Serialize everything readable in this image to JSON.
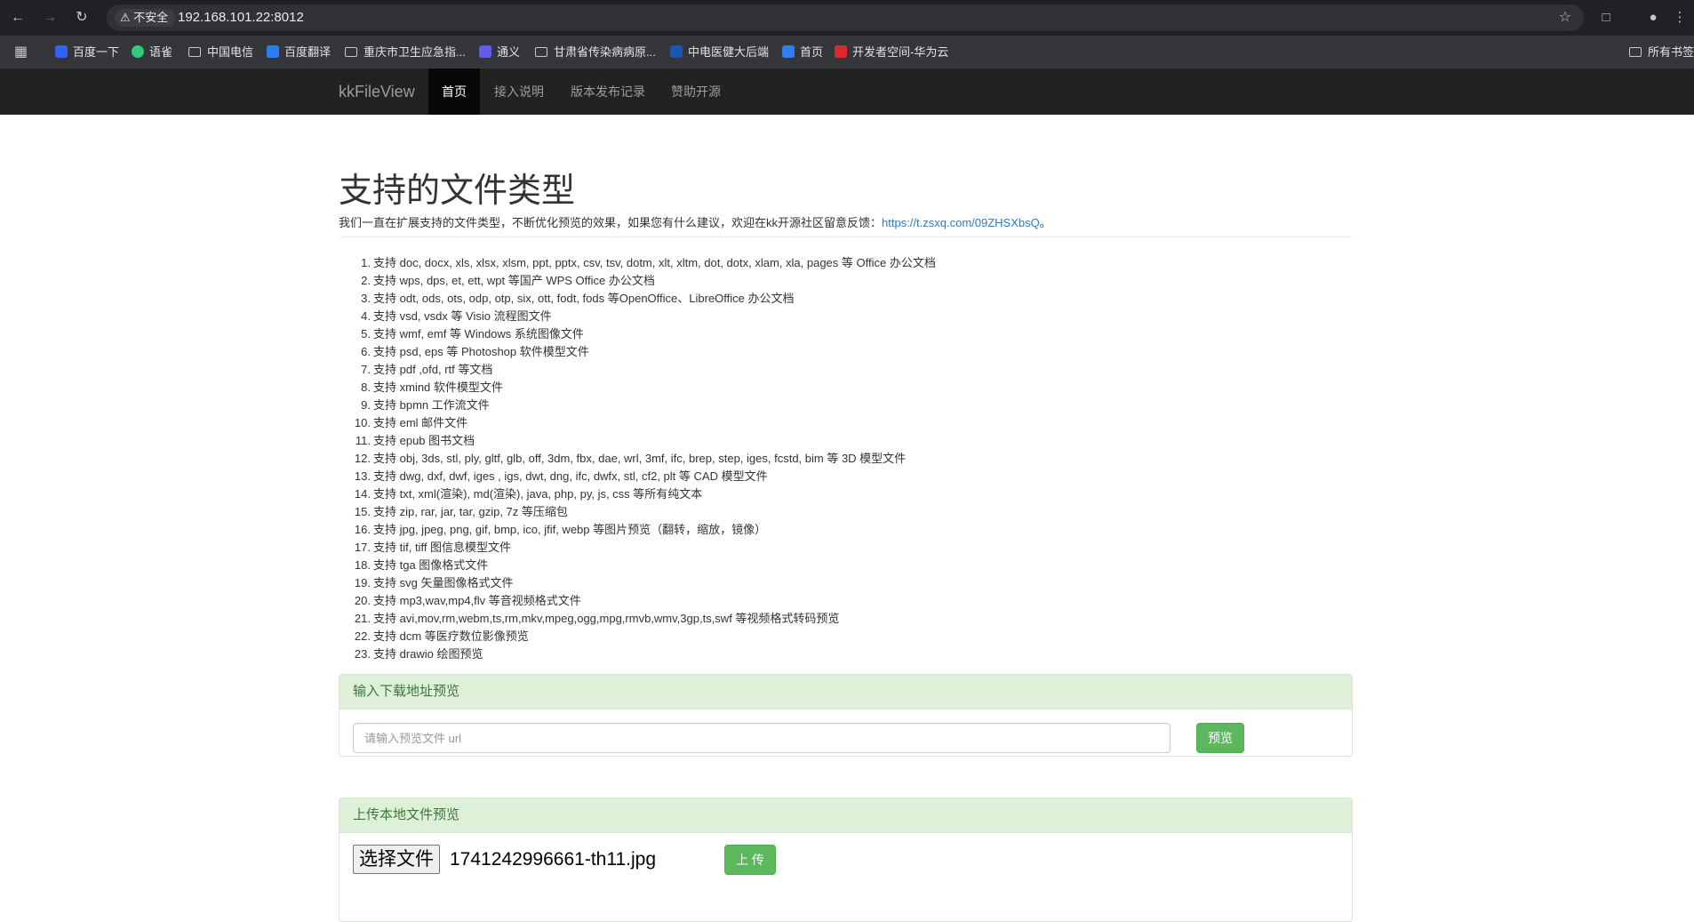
{
  "browser": {
    "insecure_label": "不安全",
    "url": "192.168.101.22:8012",
    "bookmarks": [
      {
        "label": "百度一下",
        "kind": "baidu",
        "color": "#3163f2"
      },
      {
        "label": "语雀",
        "kind": "yuque",
        "color": "#31cc79"
      },
      {
        "label": "中国电信",
        "kind": "folder"
      },
      {
        "label": "百度翻译",
        "kind": "fanyi",
        "color": "#2b7cf6"
      },
      {
        "label": "重庆市卫生应急指...",
        "kind": "folder"
      },
      {
        "label": "通义",
        "kind": "tongyi",
        "color": "#615ced"
      },
      {
        "label": "甘肃省传染病病原...",
        "kind": "folder"
      },
      {
        "label": "中电医健大后端",
        "kind": "shield",
        "color": "#1a56b5"
      },
      {
        "label": "首页",
        "kind": "feather",
        "color": "#2f7ff3"
      },
      {
        "label": "开发者空间-华为云",
        "kind": "huawei",
        "color": "#e0262f"
      }
    ],
    "all_bookmarks": "所有书签"
  },
  "navbar": {
    "brand": "kkFileView",
    "items": [
      {
        "label": "首页",
        "active": true
      },
      {
        "label": "接入说明",
        "active": false
      },
      {
        "label": "版本发布记录",
        "active": false
      },
      {
        "label": "赞助开源",
        "active": false
      }
    ]
  },
  "main": {
    "title": "支持的文件类型",
    "intro_text": "我们一直在扩展支持的文件类型，不断优化预览的效果，如果您有什么建议，欢迎在kk开源社区留意反馈：",
    "intro_link": "https://t.zsxq.com/09ZHSXbsQ",
    "intro_end": "。",
    "types": [
      "支持 doc, docx, xls, xlsx, xlsm, ppt, pptx, csv, tsv, dotm, xlt, xltm, dot, dotx, xlam, xla, pages 等 Office 办公文档",
      "支持 wps, dps, et, ett, wpt 等国产 WPS Office 办公文档",
      "支持 odt, ods, ots, odp, otp, six, ott, fodt, fods 等OpenOffice、LibreOffice 办公文档",
      "支持 vsd, vsdx 等 Visio 流程图文件",
      "支持 wmf, emf 等 Windows 系统图像文件",
      "支持 psd, eps 等 Photoshop 软件模型文件",
      "支持 pdf ,ofd, rtf 等文档",
      "支持 xmind 软件模型文件",
      "支持 bpmn 工作流文件",
      "支持 eml 邮件文件",
      "支持 epub 图书文档",
      "支持 obj, 3ds, stl, ply, gltf, glb, off, 3dm, fbx, dae, wrl, 3mf, ifc, brep, step, iges, fcstd, bim 等 3D 模型文件",
      "支持 dwg, dxf, dwf, iges , igs, dwt, dng, ifc, dwfx, stl, cf2, plt 等 CAD 模型文件",
      "支持 txt, xml(渲染), md(渲染), java, php, py, js, css 等所有纯文本",
      "支持 zip, rar, jar, tar, gzip, 7z 等压缩包",
      "支持 jpg, jpeg, png, gif, bmp, ico, jfif, webp 等图片预览（翻转，缩放，镜像）",
      "支持 tif, tiff 图信息模型文件",
      "支持 tga 图像格式文件",
      "支持 svg 矢量图像格式文件",
      "支持 mp3,wav,mp4,flv 等音视频格式文件",
      "支持 avi,mov,rm,webm,ts,rm,mkv,mpeg,ogg,mpg,rmvb,wmv,3gp,ts,swf 等视频格式转码预览",
      "支持 dcm 等医疗数位影像预览",
      "支持 drawio 绘图预览"
    ]
  },
  "url_panel": {
    "heading": "输入下载地址预览",
    "placeholder": "请输入预览文件 url",
    "button": "预览"
  },
  "upload_panel": {
    "heading": "上传本地文件预览",
    "choose_button": "选择文件",
    "file_name": "1741242996661-th11.jpg",
    "upload_button": "上 传"
  }
}
